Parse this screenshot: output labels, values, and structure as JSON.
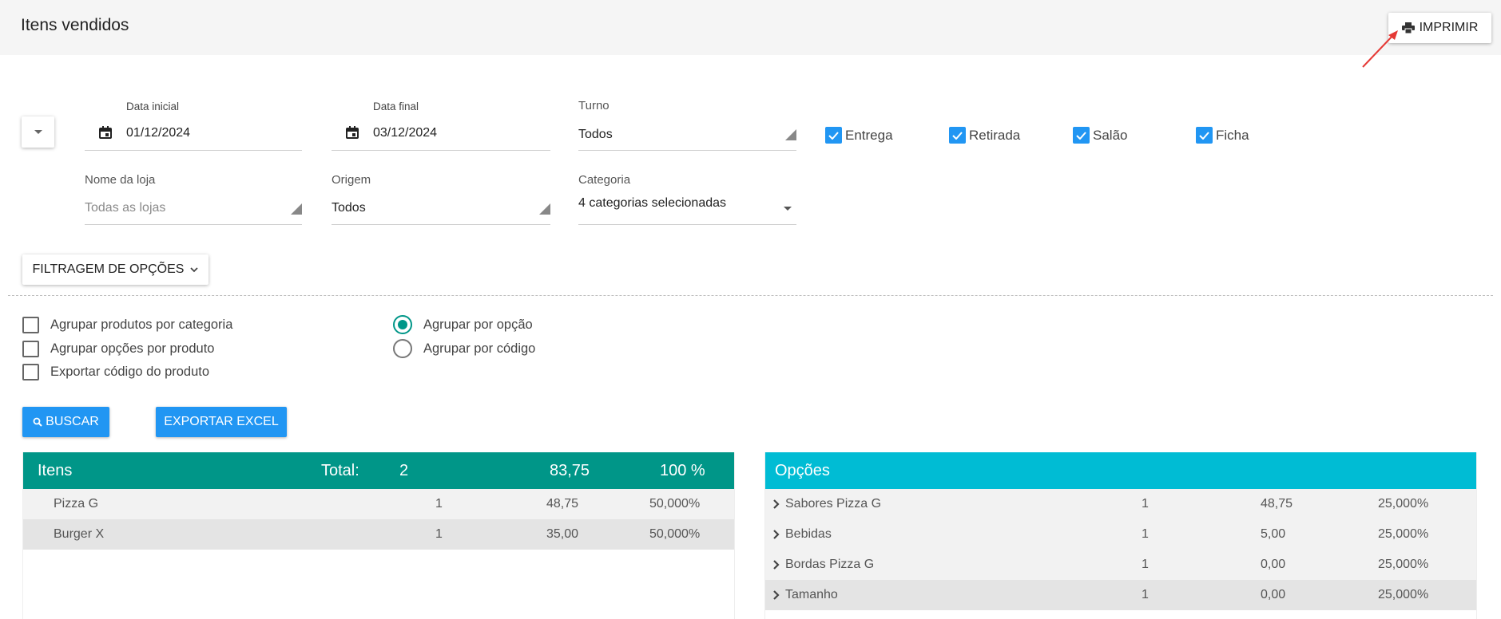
{
  "header": {
    "title": "Itens vendidos",
    "print_label": "IMPRIMIR"
  },
  "filters": {
    "data_inicial": {
      "label": "Data inicial",
      "value": "01/12/2024"
    },
    "data_final": {
      "label": "Data final",
      "value": "03/12/2024"
    },
    "turno": {
      "label": "Turno",
      "value": "Todos"
    },
    "nome_loja": {
      "label": "Nome da loja",
      "placeholder": "Todas as lojas"
    },
    "origem": {
      "label": "Origem",
      "value": "Todos"
    },
    "categoria": {
      "label": "Categoria",
      "value": "4 categorias selecionadas"
    },
    "channels": [
      {
        "label": "Entrega",
        "checked": true
      },
      {
        "label": "Retirada",
        "checked": true
      },
      {
        "label": "Salão",
        "checked": true
      },
      {
        "label": "Ficha",
        "checked": true
      }
    ],
    "filtragem_label": "FILTRAGEM DE OPÇÕES"
  },
  "options": {
    "checkboxes": [
      {
        "label": "Agrupar produtos por categoria",
        "checked": false
      },
      {
        "label": "Agrupar opções por produto",
        "checked": false
      },
      {
        "label": "Exportar código do produto",
        "checked": false
      }
    ],
    "radios": [
      {
        "label": "Agrupar por opção",
        "selected": true
      },
      {
        "label": "Agrupar por código",
        "selected": false
      }
    ]
  },
  "actions": {
    "buscar": "BUSCAR",
    "exportar": "EXPORTAR EXCEL"
  },
  "itens": {
    "title": "Itens",
    "total_label": "Total:",
    "total_qty": "2",
    "total_value": "83,75",
    "total_pct": "100 %",
    "rows": [
      {
        "name": "Pizza G",
        "qty": "1",
        "value": "48,75",
        "pct": "50,000%"
      },
      {
        "name": "Burger X",
        "qty": "1",
        "value": "35,00",
        "pct": "50,000%"
      }
    ]
  },
  "opcoes": {
    "title": "Opções",
    "rows": [
      {
        "name": "Sabores Pizza G",
        "qty": "1",
        "value": "48,75",
        "pct": "25,000%"
      },
      {
        "name": "Bebidas",
        "qty": "1",
        "value": "5,00",
        "pct": "25,000%"
      },
      {
        "name": "Bordas Pizza G",
        "qty": "1",
        "value": "0,00",
        "pct": "25,000%"
      },
      {
        "name": "Tamanho",
        "qty": "1",
        "value": "0,00",
        "pct": "25,000%"
      }
    ]
  },
  "colors": {
    "teal": "#009688",
    "cyan": "#00bcd4",
    "blue": "#2196f3",
    "arrow": "#e53935"
  }
}
